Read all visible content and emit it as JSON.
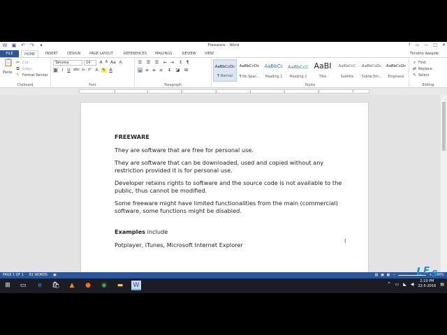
{
  "titlebar": {
    "title": "Freeware - Word",
    "qat": [
      "word-icon",
      "save-icon",
      "undo-icon",
      "redo-icon",
      "customize-icon"
    ],
    "controls": [
      "?",
      "▭",
      "—",
      "□",
      "✕"
    ]
  },
  "tabs": {
    "file": "FILE",
    "items": [
      "HOME",
      "INSERT",
      "DESIGN",
      "PAGE LAYOUT",
      "REFERENCES",
      "MAILINGS",
      "REVIEW",
      "VIEW"
    ],
    "user": "Timothy Awojide"
  },
  "ribbon": {
    "clipboard": {
      "paste": "Paste",
      "cut": "Cut",
      "copy": "Copy",
      "format_painter": "Format Painter",
      "label": "Clipboard"
    },
    "font": {
      "family": "Tahoma",
      "size": "14",
      "label": "Font"
    },
    "paragraph": {
      "label": "Paragraph"
    },
    "styles": {
      "label": "Styles",
      "items": [
        {
          "preview": "AaBbCcDc",
          "name": "¶ Normal"
        },
        {
          "preview": "AaBbCcDc",
          "name": "¶ No Spac..."
        },
        {
          "preview": "AaBbCc",
          "name": "Heading 1"
        },
        {
          "preview": "AaBbCcC",
          "name": "Heading 2"
        },
        {
          "preview": "AaBI",
          "name": "Title"
        },
        {
          "preview": "AaBbCcC",
          "name": "Subtitle"
        },
        {
          "preview": "AaBbCcDc",
          "name": "Subtle Em..."
        },
        {
          "preview": "AaBbCcDc",
          "name": "Emphasis"
        }
      ]
    },
    "editing": {
      "find": "Find",
      "replace": "Replace",
      "select": "Select",
      "label": "Editing"
    }
  },
  "ruler": {
    "numbers": [
      "1",
      "1",
      "2",
      "3",
      "4",
      "5",
      "6",
      "7"
    ]
  },
  "document": {
    "heading": "FREEWARE",
    "paragraphs": [
      "They are software that are free for personal use.",
      "They are software that can be downloaded, used and copied without any restriction provided it is for personal use.",
      "Developer retains rights to software and the source code is not available to the public, thus cannot be modified.",
      "Some freeware might have limited functionalities from the main (commercial) software, some functions might be disabled."
    ],
    "examples_bold": "Examples",
    "examples_rest": " include",
    "examples_list": "Potplayer, iTunes, Microsoft Internet Explorer"
  },
  "statusbar": {
    "page": "PAGE 1 OF 1",
    "words": "81 WORDS",
    "zoom": "100%"
  },
  "taskbar": {
    "time": "2:19 PM",
    "date": "22-5-2016"
  },
  "colors": {
    "accent": "#2b579a",
    "taskbar": "#1c1c24"
  }
}
